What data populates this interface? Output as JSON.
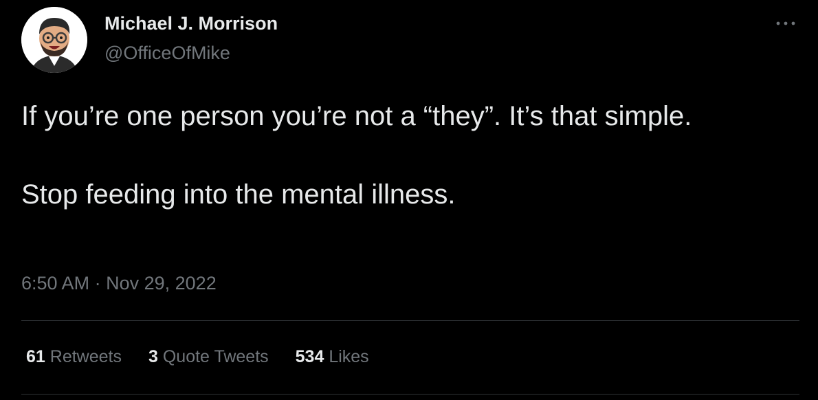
{
  "author": {
    "name": "Michael J. Morrison",
    "handle": "@OfficeOfMike",
    "avatar_icon": "bitmoji-avatar"
  },
  "menu": {
    "icon": "more-horizontal-icon"
  },
  "tweet": {
    "paragraphs": [
      "If you’re one person you’re not a “they”. It’s that simple.",
      "Stop feeding into the mental illness."
    ],
    "time": "6:50 AM",
    "separator": "·",
    "date": "Nov 29, 2022"
  },
  "stats": {
    "retweets": {
      "count": "61",
      "label": "Retweets"
    },
    "quote_tweets": {
      "count": "3",
      "label": "Quote Tweets"
    },
    "likes": {
      "count": "534",
      "label": "Likes"
    }
  },
  "colors": {
    "background": "#000000",
    "primary_text": "#e7e9ea",
    "secondary_text": "#71767b",
    "divider": "#2f3336"
  }
}
